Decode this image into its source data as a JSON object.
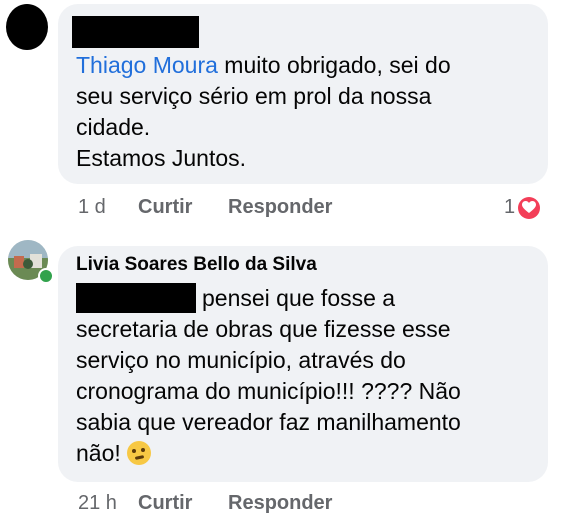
{
  "comment1": {
    "mention": "Thiago Moura",
    "line1_rest": " muito obrigado, sei do",
    "line2": "seu serviço sério em prol da nossa",
    "line3": "cidade.",
    "line4": "Estamos Juntos.",
    "time": "1 d",
    "like_label": "Curtir",
    "reply_label": "Responder",
    "reaction_count": "1",
    "reaction_icon": "heart-icon",
    "reaction_color": "#f33e58"
  },
  "comment2": {
    "author": "Livia Soares Bello da Silva",
    "line1": "pensei que fosse a",
    "line2": "secretaria de obras que fizesse esse",
    "line3": "serviço no município, através do",
    "line4": "cronograma do município!!! ???? Não",
    "line5": "sabia que vereador faz manilhamento",
    "line6": "não! ",
    "emoji": "thinking-face-icon",
    "time": "21 h",
    "like_label": "Curtir",
    "reply_label": "Responder"
  },
  "colors": {
    "bubble": "#f0f2f5",
    "mention": "#216fdb",
    "meta": "#65676b"
  }
}
